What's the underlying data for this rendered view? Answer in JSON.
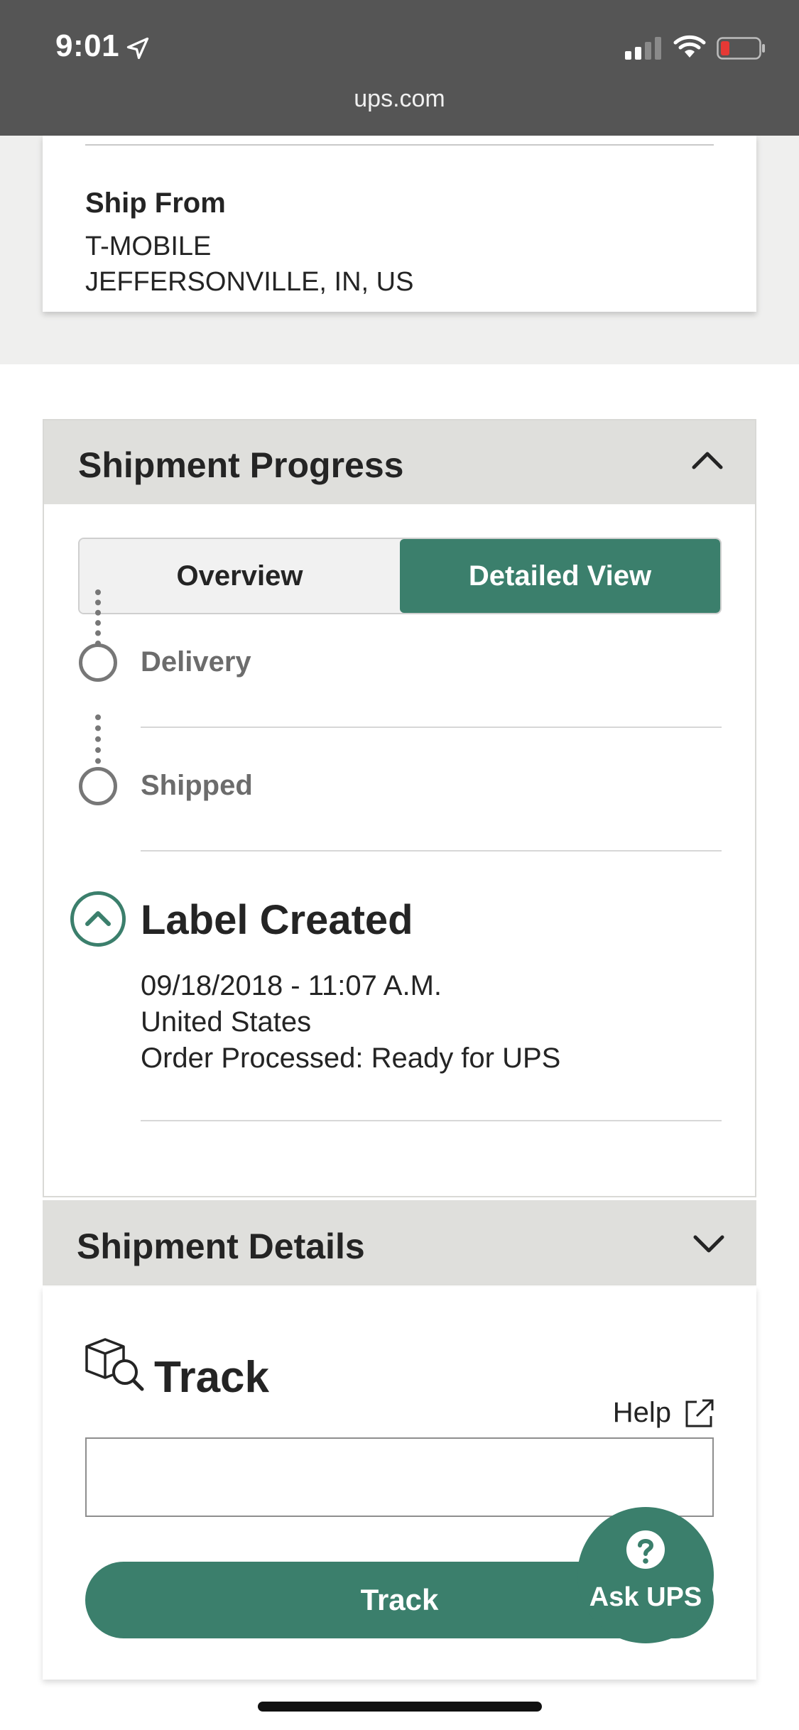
{
  "status_bar": {
    "time": "9:01"
  },
  "browser": {
    "url": "ups.com"
  },
  "ship_from": {
    "label": "Ship From",
    "line1": "T-MOBILE",
    "line2": "JEFFERSONVILLE, IN, US"
  },
  "shipment_progress": {
    "title": "Shipment Progress",
    "tabs": {
      "overview": "Overview",
      "detailed": "Detailed View",
      "selected": "Detailed View"
    },
    "steps": [
      {
        "label": "Delivery"
      },
      {
        "label": "Shipped"
      },
      {
        "label": "Label Created",
        "datetime": "09/18/2018 - 11:07 A.M.",
        "location": "United States",
        "activity": "Order Processed: Ready for UPS"
      }
    ]
  },
  "shipment_details": {
    "title": "Shipment Details"
  },
  "track": {
    "title": "Track",
    "help_label": "Help",
    "input_value": "",
    "button_label": "Track"
  },
  "ask_ups": {
    "label": "Ask UPS"
  },
  "colors": {
    "accent": "#3b7f6c",
    "header_bg": "#dfdfdc",
    "status_bar": "#555555"
  }
}
